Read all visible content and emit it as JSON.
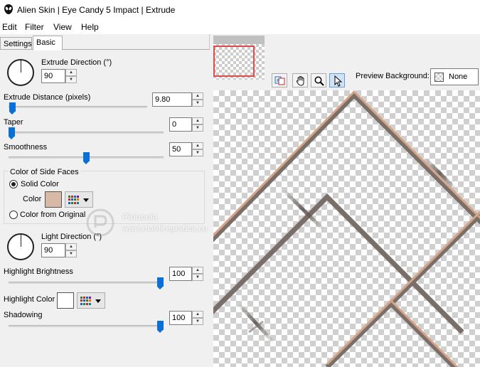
{
  "window": {
    "title": "Alien Skin | Eye Candy 5 Impact | Extrude",
    "icon": "alien-skin-icon"
  },
  "menu": {
    "items": [
      "Edit",
      "Filter",
      "View",
      "Help"
    ]
  },
  "tabs": {
    "settings": "Settings",
    "basic": "Basic",
    "active": "Basic"
  },
  "extrude_direction": {
    "label": "Extrude Direction (°)",
    "value": "90"
  },
  "extrude_distance": {
    "label": "Extrude Distance (pixels)",
    "value": "9.80",
    "slider_fraction": 0.0
  },
  "taper": {
    "label": "Taper",
    "value": "0",
    "slider_fraction": 0.0
  },
  "smoothness": {
    "label": "Smoothness",
    "value": "50",
    "slider_fraction": 0.5
  },
  "side_faces": {
    "group_label": "Color of Side Faces",
    "solid_color_label": "Solid Color",
    "color_label": "Color",
    "color_value": "#d8b9a5",
    "from_original_label": "Color from Original",
    "selected": "Solid Color"
  },
  "light_direction": {
    "label": "Light Direction (°)",
    "value": "90"
  },
  "highlight_brightness": {
    "label": "Highlight Brightness",
    "value": "100",
    "slider_fraction": 1.0
  },
  "highlight_color": {
    "label": "Highlight Color",
    "color_value": "#ffffff"
  },
  "shadowing": {
    "label": "Shadowing",
    "value": "100",
    "slider_fraction": 1.0
  },
  "preview": {
    "background_label": "Preview Background:",
    "background_value": "None",
    "tools": [
      "cycle-view-tool",
      "hand-tool",
      "zoom-tool",
      "select-tool"
    ],
    "active_tool": "select-tool"
  },
  "watermark": {
    "name": "Pinuccia",
    "url": "www.maldiregrafica.eu"
  },
  "colors": {
    "slider_thumb": "#0a6fd6",
    "nav_highlight": "#e04a4a",
    "extrude_face": "#d4a488",
    "extrude_shadow": "#6e625c"
  }
}
